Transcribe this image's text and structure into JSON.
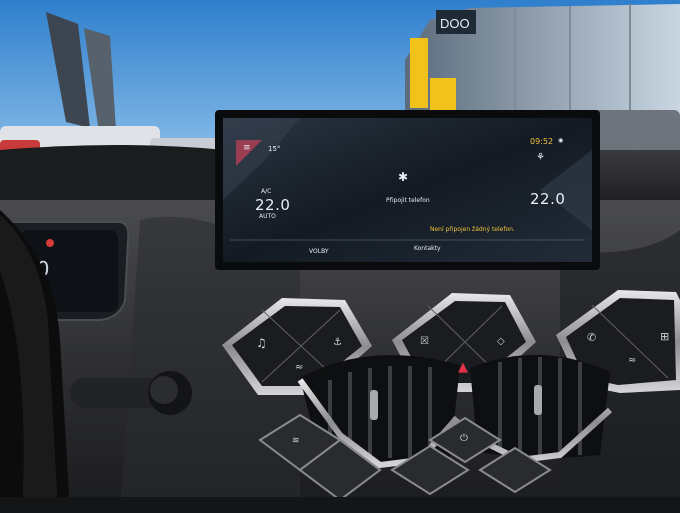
{
  "screen": {
    "outside_temp": "15°",
    "clock": "09:52",
    "left_climate": {
      "mode": "A/C",
      "temp": "22.0",
      "fan": "AUTO"
    },
    "right_climate": {
      "temp": "22.0"
    },
    "bluetooth": {
      "label": "Připojit telefon"
    },
    "status_message": "Není připojen žádný telefon.",
    "bottom_left": "VOLBY",
    "bottom_center": "Kontakty"
  },
  "cluster": {
    "speed": "00"
  },
  "dealer_sign": "DOO",
  "colors": {
    "screen_accent": "#f0c23a",
    "corner_badge": "#e5384b",
    "hazard": "#e0314a",
    "sky": "#3d88d2",
    "dash": "#2a2b2d"
  },
  "icons": [
    "menu-icon",
    "bluetooth-icon",
    "location-pin-icon",
    "fan-seat-icon",
    "music-icon",
    "seat-heat-icon",
    "car-recirculation-icon",
    "mute-icon",
    "car-icon",
    "hazard-icon",
    "phone-icon",
    "grid-apps-icon",
    "power-icon",
    "defrost-icon"
  ]
}
